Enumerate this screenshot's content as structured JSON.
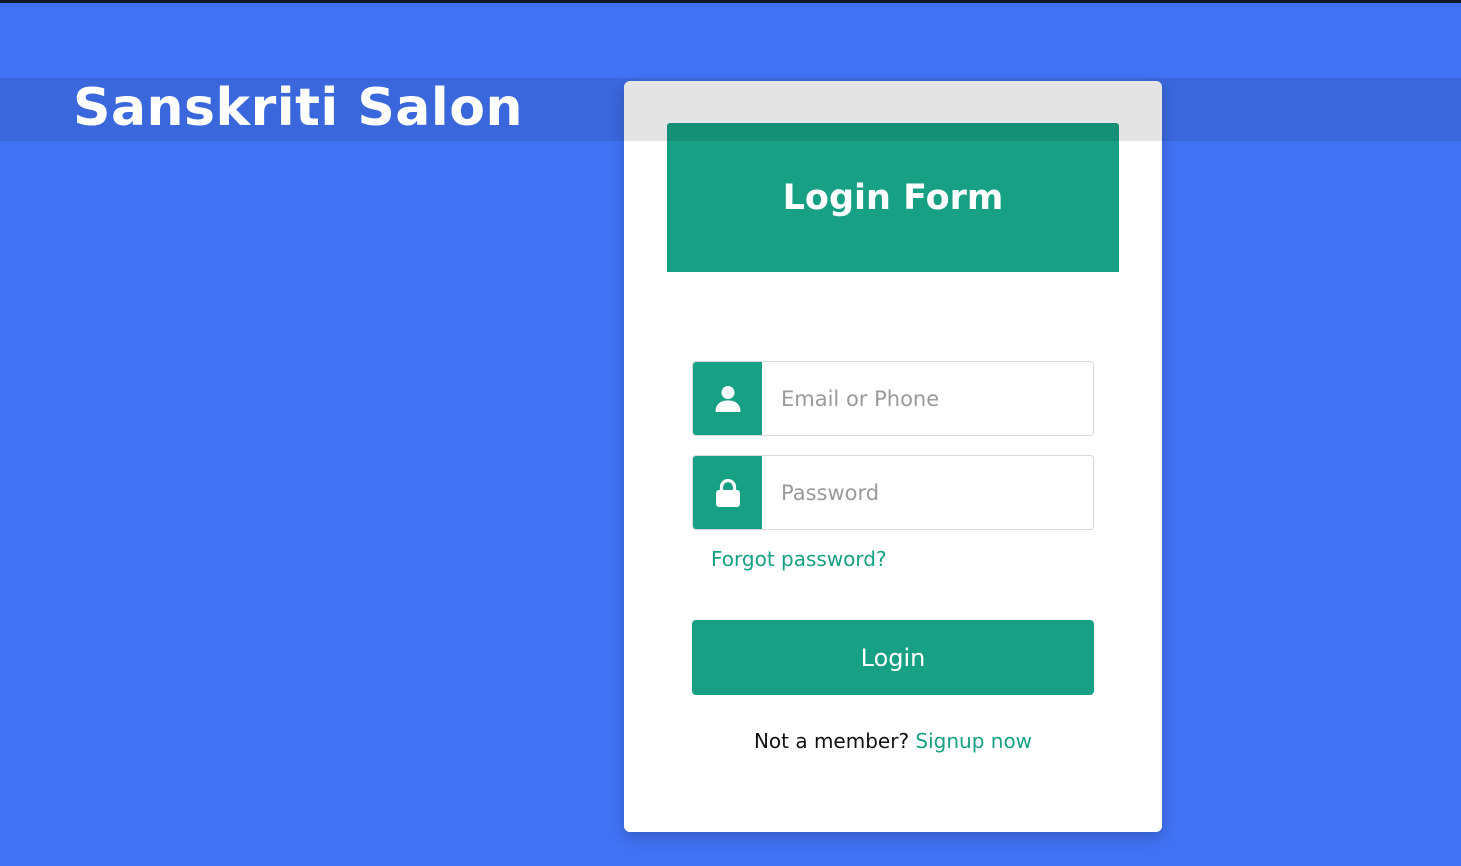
{
  "brand": {
    "title": "Sanskriti Salon"
  },
  "login_form": {
    "title": "Login Form",
    "email_placeholder": "Email or Phone",
    "email_value": "",
    "password_placeholder": "Password",
    "password_value": "",
    "forgot_password_label": "Forgot password?",
    "login_button_label": "Login",
    "signup_prompt": "Not a member?",
    "signup_link_label": "Signup now"
  },
  "icons": {
    "email_icon": "user-icon",
    "password_icon": "lock-icon"
  },
  "colors": {
    "background": "#4172f3",
    "header_band": "#3a67db",
    "accent": "#18a085",
    "card": "#ffffff"
  }
}
